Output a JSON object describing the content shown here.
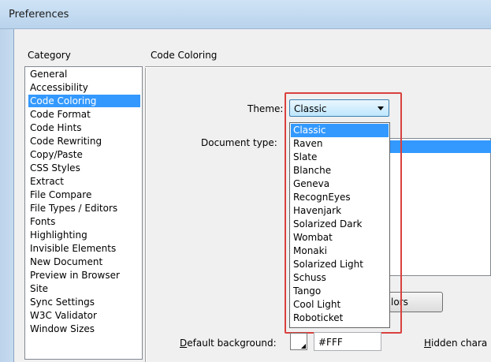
{
  "window": {
    "title": "Preferences"
  },
  "labels": {
    "category": "Category",
    "section": "Code Coloring",
    "theme": "Theme:",
    "document_type": "Document type:",
    "default_background_u": "D",
    "default_background_rest": "efault background:",
    "hidden_chars_u": "H",
    "hidden_chars_rest": "idden chara"
  },
  "categories": [
    "General",
    "Accessibility",
    "Code Coloring",
    "Code Format",
    "Code Hints",
    "Code Rewriting",
    "Copy/Paste",
    "CSS Styles",
    "Extract",
    "File Compare",
    "File Types / Editors",
    "Fonts",
    "Highlighting",
    "Invisible Elements",
    "New Document",
    "Preview in Browser",
    "Site",
    "Sync Settings",
    "W3C Validator",
    "Window Sizes"
  ],
  "selected_category": "Code Coloring",
  "theme": {
    "selected": "Classic",
    "options": [
      "Classic",
      "Raven",
      "Slate",
      "Blanche",
      "Geneva",
      "RecognEyes",
      "Havenjark",
      "Solarized Dark",
      "Wombat",
      "Monaki",
      "Solarized Light",
      "Schuss",
      "Tango",
      "Cool Light",
      "Roboticket"
    ]
  },
  "buttons": {
    "edit_colors_visible_fragment": "lors"
  },
  "default_background": {
    "value": "#FFF"
  },
  "colors": {
    "selection": "#3399ff",
    "highlight": "#d9413e"
  }
}
